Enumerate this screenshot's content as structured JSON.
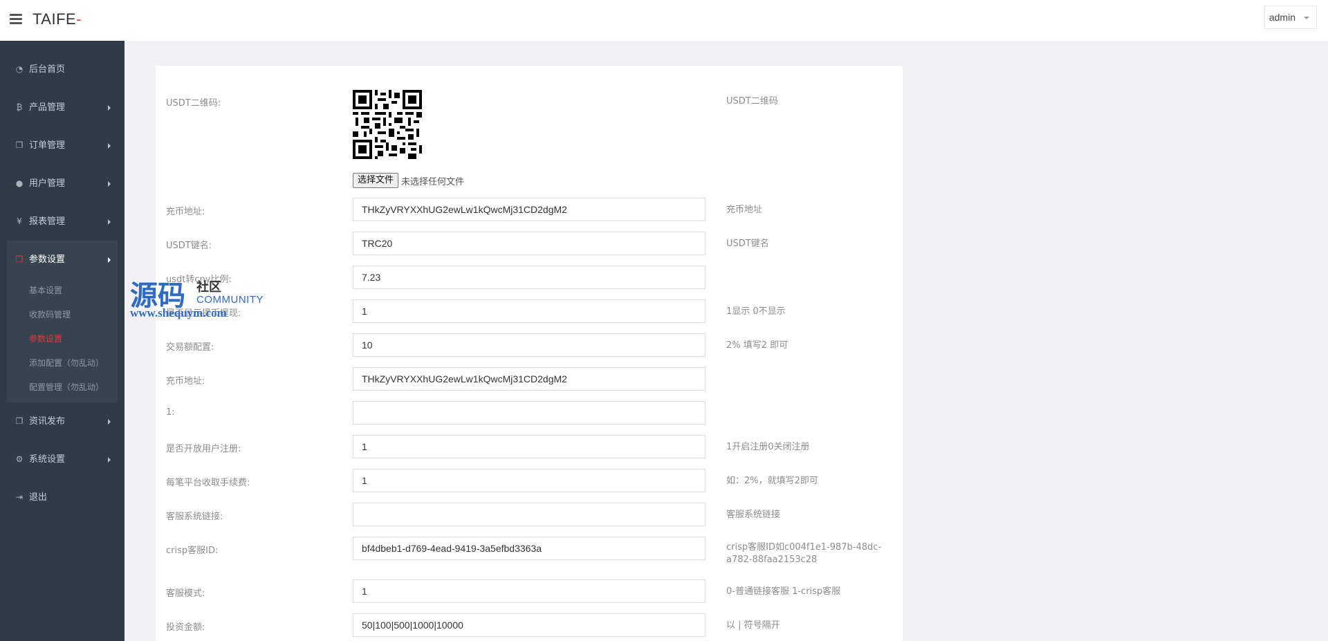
{
  "header": {
    "brand": "TAIFE",
    "brand_accent": "-",
    "user_label": "admin"
  },
  "sidebar": {
    "items": [
      {
        "label": "后台首页",
        "icon": "dashboard-icon"
      },
      {
        "label": "产品管理",
        "icon": "bitcoin-icon"
      },
      {
        "label": "订单管理",
        "icon": "copy-icon"
      },
      {
        "label": "用户管理",
        "icon": "user-icon"
      },
      {
        "label": "报表管理",
        "icon": "yen-icon"
      },
      {
        "label": "参数设置",
        "icon": "copy-icon"
      },
      {
        "label": "资讯发布",
        "icon": "copy-icon"
      },
      {
        "label": "系统设置",
        "icon": "gears-icon"
      },
      {
        "label": "退出",
        "icon": "sign-out-icon"
      }
    ],
    "sub_items": [
      "基本设置",
      "收款码管理",
      "参数设置",
      "添加配置（勿乱动）",
      "配置管理（勿乱动）"
    ]
  },
  "form": {
    "qr": {
      "label": "USDT二维码:",
      "hint": "USDT二维码"
    },
    "file": {
      "button": "选择文件",
      "status": "未选择任何文件"
    },
    "rows": [
      {
        "label": "充币地址:",
        "value": "THkZyVRYXXhUG2ewLw1kQwcMj31CD2dgM2",
        "hint": "充币地址"
      },
      {
        "label": "USDT键名:",
        "value": "TRC20",
        "hint": "USDT键名"
      },
      {
        "label": "usdt转cny比例:",
        "value": "7.23",
        "hint": ""
      },
      {
        "label": "是否显示提币提现:",
        "value": "1",
        "hint": "1显示 0不显示"
      },
      {
        "label": "交易额配置:",
        "value": "10",
        "hint": "2% 填写2 即可"
      },
      {
        "label": "充币地址:",
        "value": "THkZyVRYXXhUG2ewLw1kQwcMj31CD2dgM2",
        "hint": ""
      },
      {
        "label": "1:",
        "value": "",
        "hint": ""
      },
      {
        "label": "是否开放用户注册:",
        "value": "1",
        "hint": "1开启注册0关闭注册"
      },
      {
        "label": "每笔平台收取手续费:",
        "value": "1",
        "hint": "如：2%，就填写2即可"
      },
      {
        "label": "客服系统链接:",
        "value": "",
        "hint": "客服系统链接"
      },
      {
        "label": "crisp客服ID:",
        "value": "bf4dbeb1-d769-4ead-9419-3a5efbd3363a",
        "hint": "crisp客服ID如c004f1e1-987b-48dc-a782-88faa2153c28"
      },
      {
        "label": "客服模式:",
        "value": "1",
        "hint": "0-普通链接客服 1-crisp客服"
      },
      {
        "label": "投资金额:",
        "value": "50|100|500|1000|10000",
        "hint": "以 | 符号隔开"
      }
    ]
  },
  "watermark": {
    "big": "源码",
    "small": "社区",
    "community": "COMMUNITY",
    "url": "www.shequym.com"
  }
}
